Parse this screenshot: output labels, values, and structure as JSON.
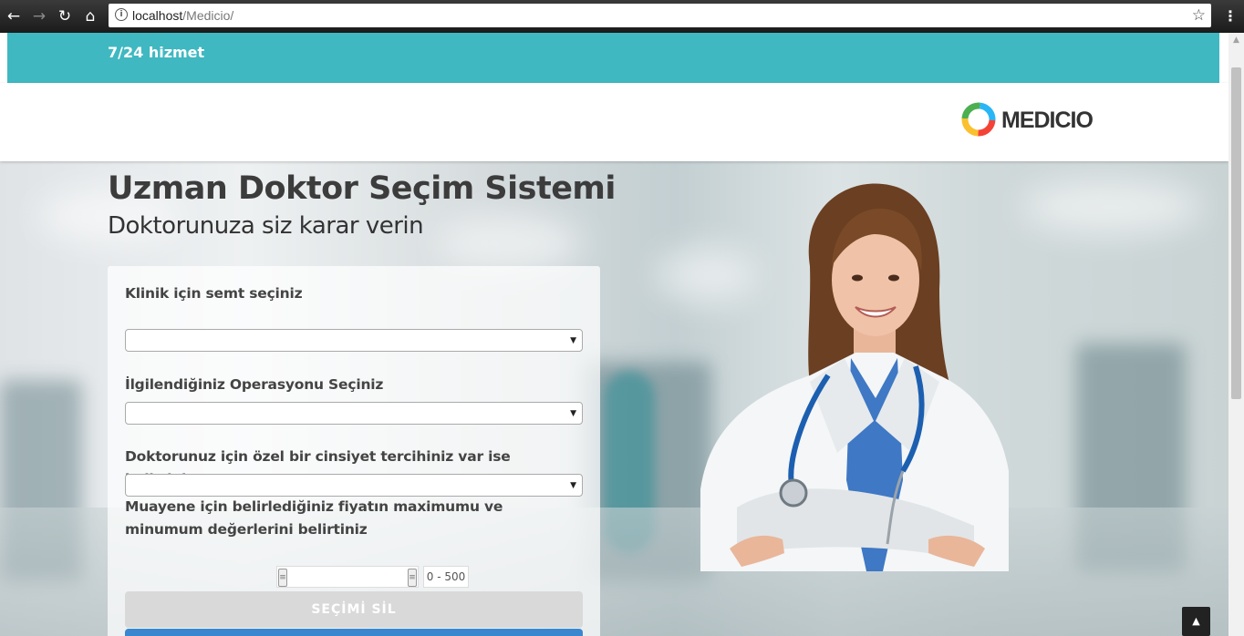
{
  "browser": {
    "url_host": "localhost",
    "url_path": "/Medicio/"
  },
  "topbar": {
    "service_text": "7/24 hizmet"
  },
  "header": {
    "logo_text": "MEDICIO"
  },
  "hero": {
    "title": "Uzman Doktor Seçim Sistemi",
    "subtitle": "Doktorunuza siz karar verin"
  },
  "form": {
    "district_label": "Klinik için semt seçiniz",
    "district_value": "",
    "operation_label": "İlgilendiğiniz Operasyonu Seçiniz",
    "operation_value": "",
    "gender_label": "Doktorunuz için özel bir cinsiyet tercihiniz var ise belirtiniz",
    "gender_value": "",
    "price_label": "Muayene için belirlediğiniz fiyatın maximumu ve minumum değerlerini belirtiniz",
    "price_range": "0 - 500",
    "price_min": 0,
    "price_max": 500,
    "clear_button": "SEÇİMİ SİL"
  },
  "icons": {
    "back": "arrow-left-icon",
    "forward": "arrow-right-icon",
    "reload": "reload-icon",
    "home": "home-icon",
    "info": "info-icon",
    "bookmark": "star-icon",
    "menu": "kebab-menu-icon",
    "back_to_top": "chevron-up-icon",
    "select_arrow": "caret-down-icon"
  },
  "colors": {
    "topbar": "#3fb8c1",
    "submit_button": "#3a87d0",
    "clear_button": "#d9d9d9",
    "title_text": "#3c3c3c"
  }
}
